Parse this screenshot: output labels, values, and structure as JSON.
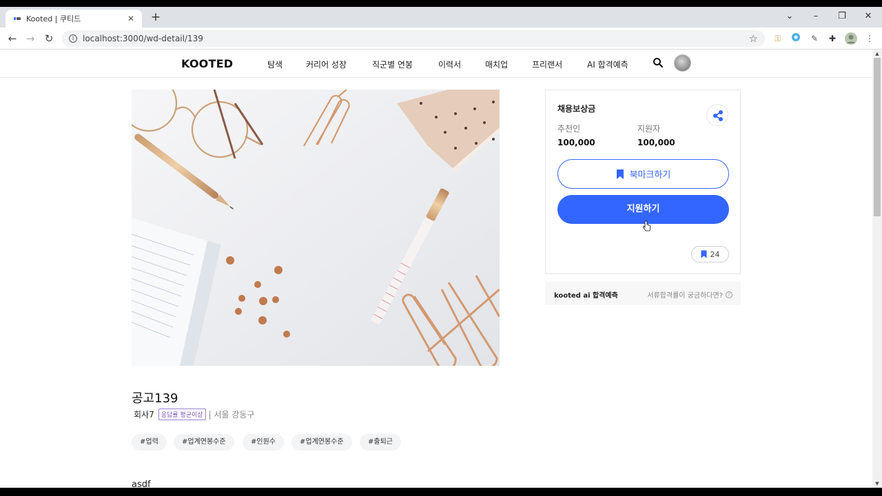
{
  "browser": {
    "tab_title": "Kooted | 쿠티드",
    "tab_close": "✕",
    "new_tab": "+",
    "url": "localhost:3000/wd-detail/139",
    "window_controls": {
      "collapse": "⌄",
      "minimize": "–",
      "restore": "❐",
      "close": "✕"
    }
  },
  "header": {
    "logo": "KOOTED",
    "nav": [
      "탐색",
      "커리어 성장",
      "직군별 연봉",
      "이력서",
      "매치업",
      "프리랜서",
      "AI 합격예측"
    ],
    "icons": [
      "search-icon",
      "avatar"
    ]
  },
  "job": {
    "title": "공고139",
    "company": "회사7",
    "response_badge": "응답률 평균이상",
    "location": "| 서울 강동구",
    "tags": [
      "#업력",
      "#업계연봉수준",
      "#인원수",
      "#업계연봉수준",
      "#출퇴근"
    ],
    "description": "asdf"
  },
  "reward": {
    "title": "채용보상금",
    "recommender_label": "추천인",
    "recommender_value": "100,000",
    "applicant_label": "지원자",
    "applicant_value": "100,000",
    "bookmark_label": "북마크하기",
    "apply_label": "지원하기",
    "bookmark_count": "24"
  },
  "ai_predict": {
    "label": "kooted ai 합격예측",
    "hint": "서류합격률이 궁금하다면?",
    "help": "?"
  },
  "colors": {
    "accent": "#3366ff",
    "badge": "#7e57c2"
  }
}
